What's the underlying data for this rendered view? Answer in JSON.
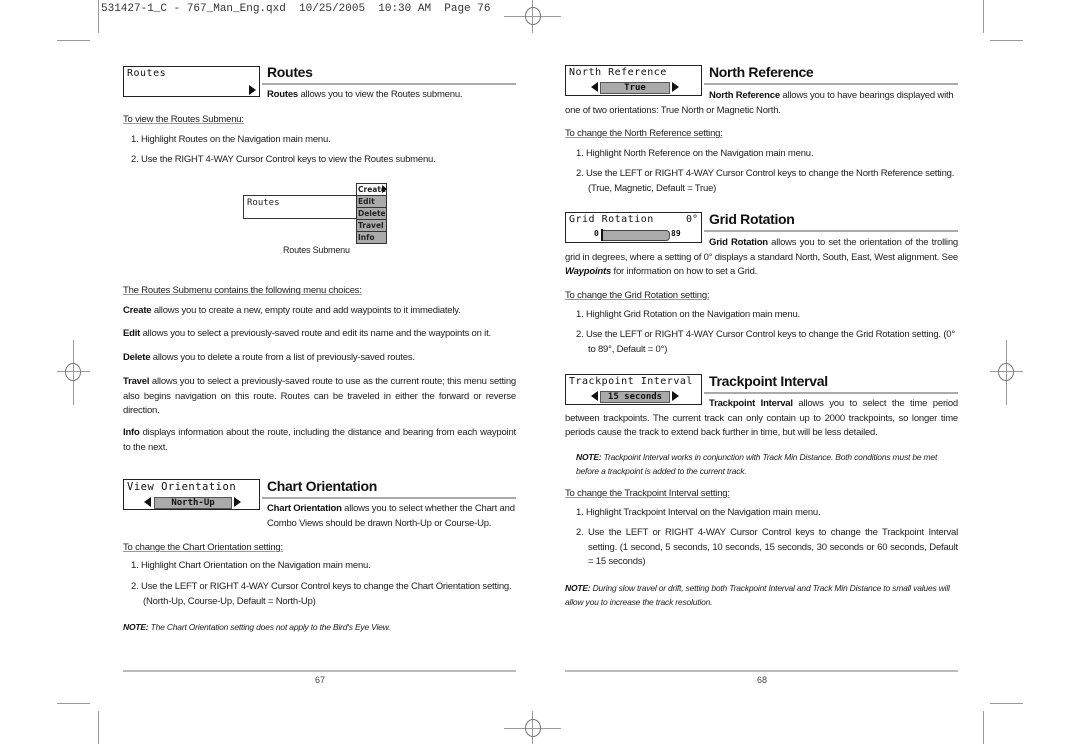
{
  "slug": "531427-1_C - 767_Man_Eng.qxd  10/25/2005  10:30 AM  Page 76",
  "left_page": {
    "page_number": "67",
    "routes": {
      "ui_title": "Routes",
      "heading": "Routes",
      "intro_bold": "Routes",
      "intro_rest": " allows you to view the Routes submenu.",
      "subheading": "To view the Routes Submenu:",
      "steps": [
        "1.  Highlight Routes on the Navigation main menu.",
        "2.  Use the RIGHT 4-WAY Cursor Control keys to view the Routes submenu."
      ],
      "submenu": {
        "main_label": "Routes",
        "items": [
          "Create",
          "Edit",
          "Delete",
          "Travel",
          "Info"
        ],
        "caption": "Routes Submenu"
      },
      "choices_heading": "The Routes Submenu contains the following menu choices:",
      "choices": [
        {
          "term": "Create",
          "desc": " allows you to create a new, empty route and add waypoints to it immediately."
        },
        {
          "term": "Edit",
          "desc": " allows you to select a previously-saved route and edit its name and the waypoints on it."
        },
        {
          "term": "Delete",
          "desc": " allows you to delete a route from a list of previously-saved routes."
        },
        {
          "term": "Travel",
          "desc": " allows you to select a previously-saved route to use as the current route; this menu setting also begins navigation on this route. Routes can be traveled in either the forward or reverse direction."
        },
        {
          "term": "Info",
          "desc": " displays information about the route, including the distance and bearing from each waypoint to the next."
        }
      ]
    },
    "chart_orientation": {
      "ui_title": "View Orientation",
      "ui_value": "North-Up",
      "heading": "Chart Orientation",
      "intro_bold": "Chart Orientation",
      "intro_rest": " allows you to select whether the Chart and Combo Views should be drawn North-Up or Course-Up.",
      "subheading": "To change the Chart Orientation setting:",
      "steps": [
        "1.  Highlight Chart Orientation on the Navigation main menu.",
        "2.  Use the LEFT or RIGHT 4-WAY Cursor Control keys to change the Chart Orientation setting. (North-Up, Course-Up, Default = North-Up)"
      ],
      "note_label": "NOTE:",
      "note_text": "  The Chart Orientation setting does not apply to the Bird's Eye View."
    }
  },
  "right_page": {
    "page_number": "68",
    "north_reference": {
      "ui_title": "North Reference",
      "ui_value": "True",
      "heading": "North Reference",
      "intro_bold": "North Reference",
      "intro_rest": " allows you to have bearings displayed with one of two orientations: True North or Magnetic North.",
      "subheading": "To change the North Reference setting:",
      "steps": [
        "1.  Highlight North Reference on the Navigation main menu.",
        "2.  Use the LEFT or RIGHT 4-WAY Cursor Control keys to change the North Reference setting. (True, Magnetic, Default = True)"
      ]
    },
    "grid_rotation": {
      "ui_title": "Grid Rotation",
      "ui_value": "0°",
      "slider_min": "0",
      "slider_max": "89",
      "slider_value": 0,
      "heading": "Grid Rotation",
      "intro_bold": "Grid Rotation",
      "intro_rest": " allows you to set the orientation of the trolling grid in degrees, where a setting of 0° displays a standard North, South, East, West alignment. See ",
      "intro_italic": "Waypoints",
      "intro_end": " for information on how to set a Grid.",
      "subheading": "To change the Grid Rotation setting:",
      "steps": [
        "1.  Highlight Grid Rotation on the Navigation main menu.",
        "2.  Use the LEFT or RIGHT 4-WAY Cursor Control keys to change the Grid Rotation setting. (0° to 89°, Default = 0°)"
      ]
    },
    "trackpoint_interval": {
      "ui_title": "Trackpoint Interval",
      "ui_value": "15 seconds",
      "heading": "Trackpoint Interval",
      "intro_bold": "Trackpoint Interval",
      "intro_rest": " allows you to select the time period between trackpoints.  The current track can only contain up to 2000 trackpoints, so longer time periods cause the track to extend back further in time, but will be less detailed.",
      "note1_label": "NOTE:",
      "note1_text": " Trackpoint Interval works in conjunction with Track Min Distance.  Both conditions must be met before a trackpoint is added to the current track.",
      "subheading": "To change the Trackpoint Interval setting:",
      "steps": [
        "1.  Highlight Trackpoint Interval on the Navigation main menu.",
        "2.  Use the LEFT or RIGHT 4-WAY Cursor Control keys to change the Trackpoint Interval setting. (1 second, 5 seconds, 10 seconds, 15 seconds, 30 seconds or 60 seconds, Default = 15 seconds)"
      ],
      "note2_label": "NOTE:",
      "note2_text": " During slow travel or drift, setting both Trackpoint Interval and Track Min Distance to small values will allow you to increase the track resolution."
    }
  }
}
